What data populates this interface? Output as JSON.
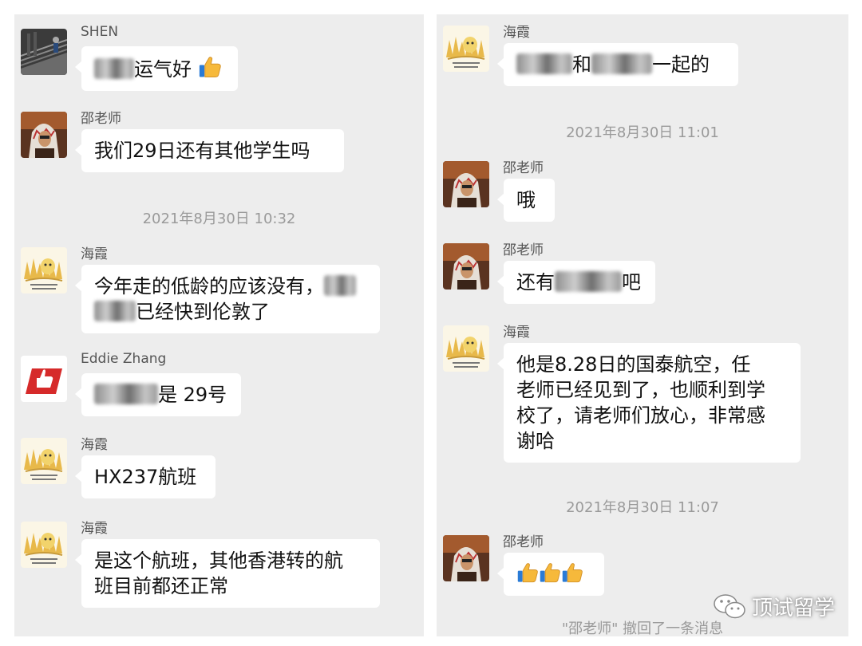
{
  "left": {
    "m1": {
      "sender": "SHEN",
      "text": "运气好"
    },
    "m2": {
      "sender": "邵老师",
      "text": "我们29日还有其他学生吗"
    },
    "ts1": "2021年8月30日 10:32",
    "m3": {
      "sender": "海霞",
      "line1": "今年走的低龄的应该没有，",
      "line2": "已经快到伦敦了"
    },
    "m4": {
      "sender": "Eddie Zhang",
      "text": "是 29号"
    },
    "m5": {
      "sender": "海霞",
      "text": "HX237航班"
    },
    "m6": {
      "sender": "海霞",
      "line1": "是这个航班，其他香港转的航",
      "line2": "班目前都还正常"
    }
  },
  "right": {
    "m1": {
      "sender": "海霞",
      "mid": "和",
      "end": "一起的"
    },
    "ts1": "2021年8月30日 11:01",
    "m2": {
      "sender": "邵老师",
      "text": "哦"
    },
    "m3": {
      "sender": "邵老师",
      "start": "还有",
      "end": "吧"
    },
    "m4": {
      "sender": "海霞",
      "line1": "他是8.28日的国泰航空，任",
      "line2": "老师已经见到了，也顺利到学",
      "line3": "校了，请老师们放心，非常感",
      "line4": "谢哈"
    },
    "ts2": "2021年8月30日 11:07",
    "m5": {
      "sender": "邵老师"
    },
    "recall": "\"邵老师\" 撤回了一条消息"
  },
  "watermark": {
    "text": "顶试留学"
  },
  "icons": {
    "thumbs_up": "thumbs-up-emoji",
    "wechat": "wechat-logo-icon"
  },
  "colors": {
    "panel_bg": "#ededed",
    "bubble_bg": "#ffffff",
    "thumb": "#f5b83d",
    "timestamp": "#9a9a9a"
  }
}
